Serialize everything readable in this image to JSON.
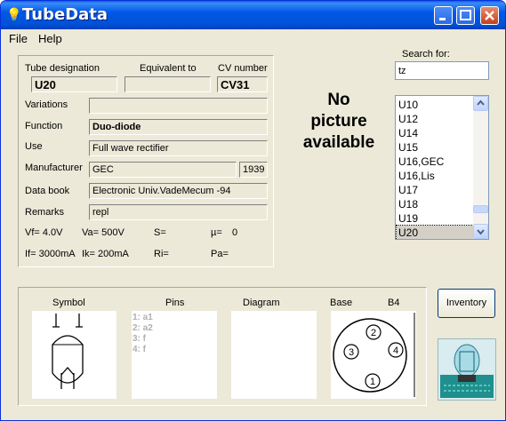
{
  "window": {
    "title": "TubeData"
  },
  "menu": {
    "file": "File",
    "help": "Help"
  },
  "details": {
    "tube_designation_label": "Tube designation",
    "tube_designation_value": "U20",
    "equivalent_label": "Equivalent to",
    "equivalent_value": "",
    "cv_label": "CV number",
    "cv_value": "CV31",
    "variations_label": "Variations",
    "variations_value": "",
    "function_label": "Function",
    "function_value": "Duo-diode",
    "use_label": "Use",
    "use_value": "Full wave rectifier",
    "manufacturer_label": "Manufacturer",
    "manufacturer_value": "GEC",
    "year_value": "1939",
    "databook_label": "Data book",
    "databook_value": "Electronic Univ.VadeMecum -94",
    "remarks_label": "Remarks",
    "remarks_value": "repl",
    "vf": "Vf= 4.0V",
    "va": "Va= 500V",
    "s": "S=",
    "mu": "µ=",
    "mu_value": "0",
    "if": "If= 3000mA",
    "ik": "Ik= 200mA",
    "ri": "Ri=",
    "pa": "Pa="
  },
  "picture": {
    "line1": "No",
    "line2": "picture",
    "line3": "available"
  },
  "search": {
    "label": "Search for:",
    "value": "tz",
    "results": [
      "U10",
      "U12",
      "U14",
      "U15",
      "U16,GEC",
      "U16,Lis",
      "U17",
      "U18",
      "U19",
      "U20"
    ],
    "selected": "U20"
  },
  "bottom": {
    "symbol_label": "Symbol",
    "pins_label": "Pins",
    "diagram_label": "Diagram",
    "base_label": "Base",
    "base_type": "B4",
    "pins": [
      "1: a1",
      "2: a2",
      "3: f",
      "4: f"
    ],
    "base_pin_numbers": [
      "1",
      "2",
      "3",
      "4"
    ]
  },
  "buttons": {
    "inventory": "Inventory"
  },
  "colors": {
    "titlebar": "#0058e7",
    "window": "#ece9d8",
    "close": "#c4411c",
    "selection": "#d4d0c8"
  },
  "icons": [
    "lightbulb-icon",
    "minimize-icon",
    "maximize-icon",
    "close-icon",
    "scroll-up-icon",
    "scroll-down-icon",
    "tube-logo-icon"
  ]
}
